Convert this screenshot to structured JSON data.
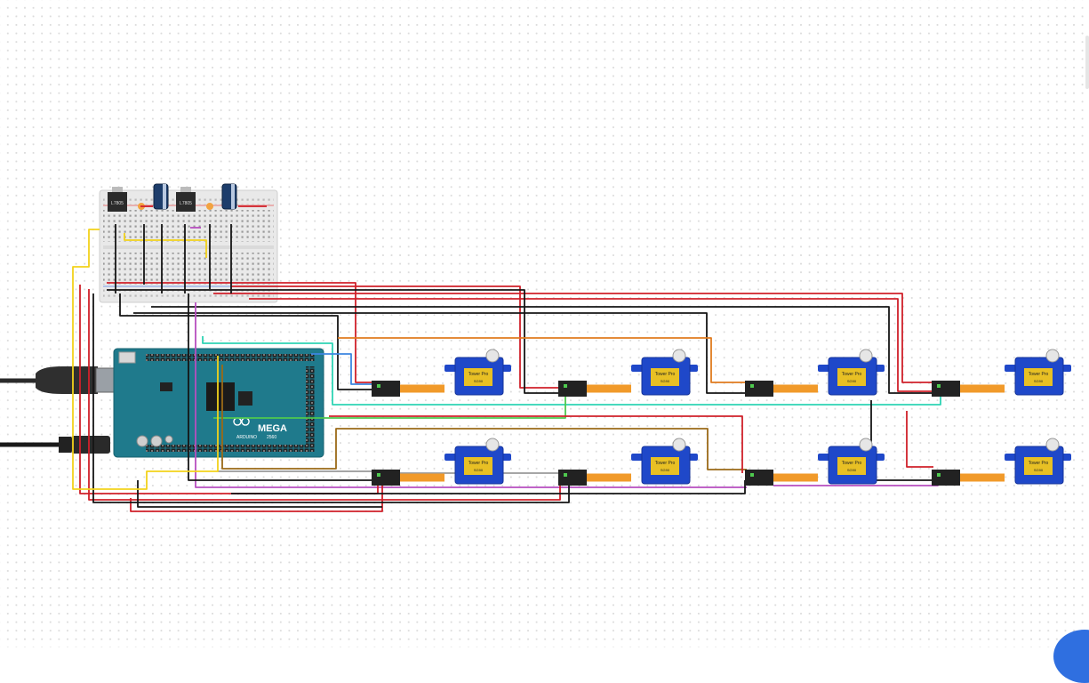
{
  "board": {
    "title": "MEGA",
    "subtitle": "ARDUINO",
    "rev": "2560"
  },
  "regulators": [
    {
      "label": "L7805"
    },
    {
      "label": "L7805"
    }
  ],
  "servos": [
    {
      "brand": "Tower Pro",
      "model": "SG90"
    },
    {
      "brand": "Tower Pro",
      "model": "SG90"
    },
    {
      "brand": "Tower Pro",
      "model": "SG90"
    },
    {
      "brand": "Tower Pro",
      "model": "SG90"
    },
    {
      "brand": "Tower Pro",
      "model": "SG90"
    },
    {
      "brand": "Tower Pro",
      "model": "SG90"
    },
    {
      "brand": "Tower Pro",
      "model": "SG90"
    },
    {
      "brand": "Tower Pro",
      "model": "SG90"
    }
  ],
  "colors": {
    "wire_red": "#d0202a",
    "wire_black": "#151515",
    "wire_yellow": "#f2d21b",
    "wire_orange": "#e07b1f",
    "wire_teal": "#2ed4b4",
    "wire_green": "#4ec94e",
    "wire_brown": "#9b6a17",
    "wire_gray": "#9a9a9a",
    "wire_purple": "#b84fc0",
    "wire_blue": "#3c86e0",
    "board": "#1f7a8c",
    "servo_body": "#1f48c9",
    "breadboard": "#e9e9e9"
  }
}
